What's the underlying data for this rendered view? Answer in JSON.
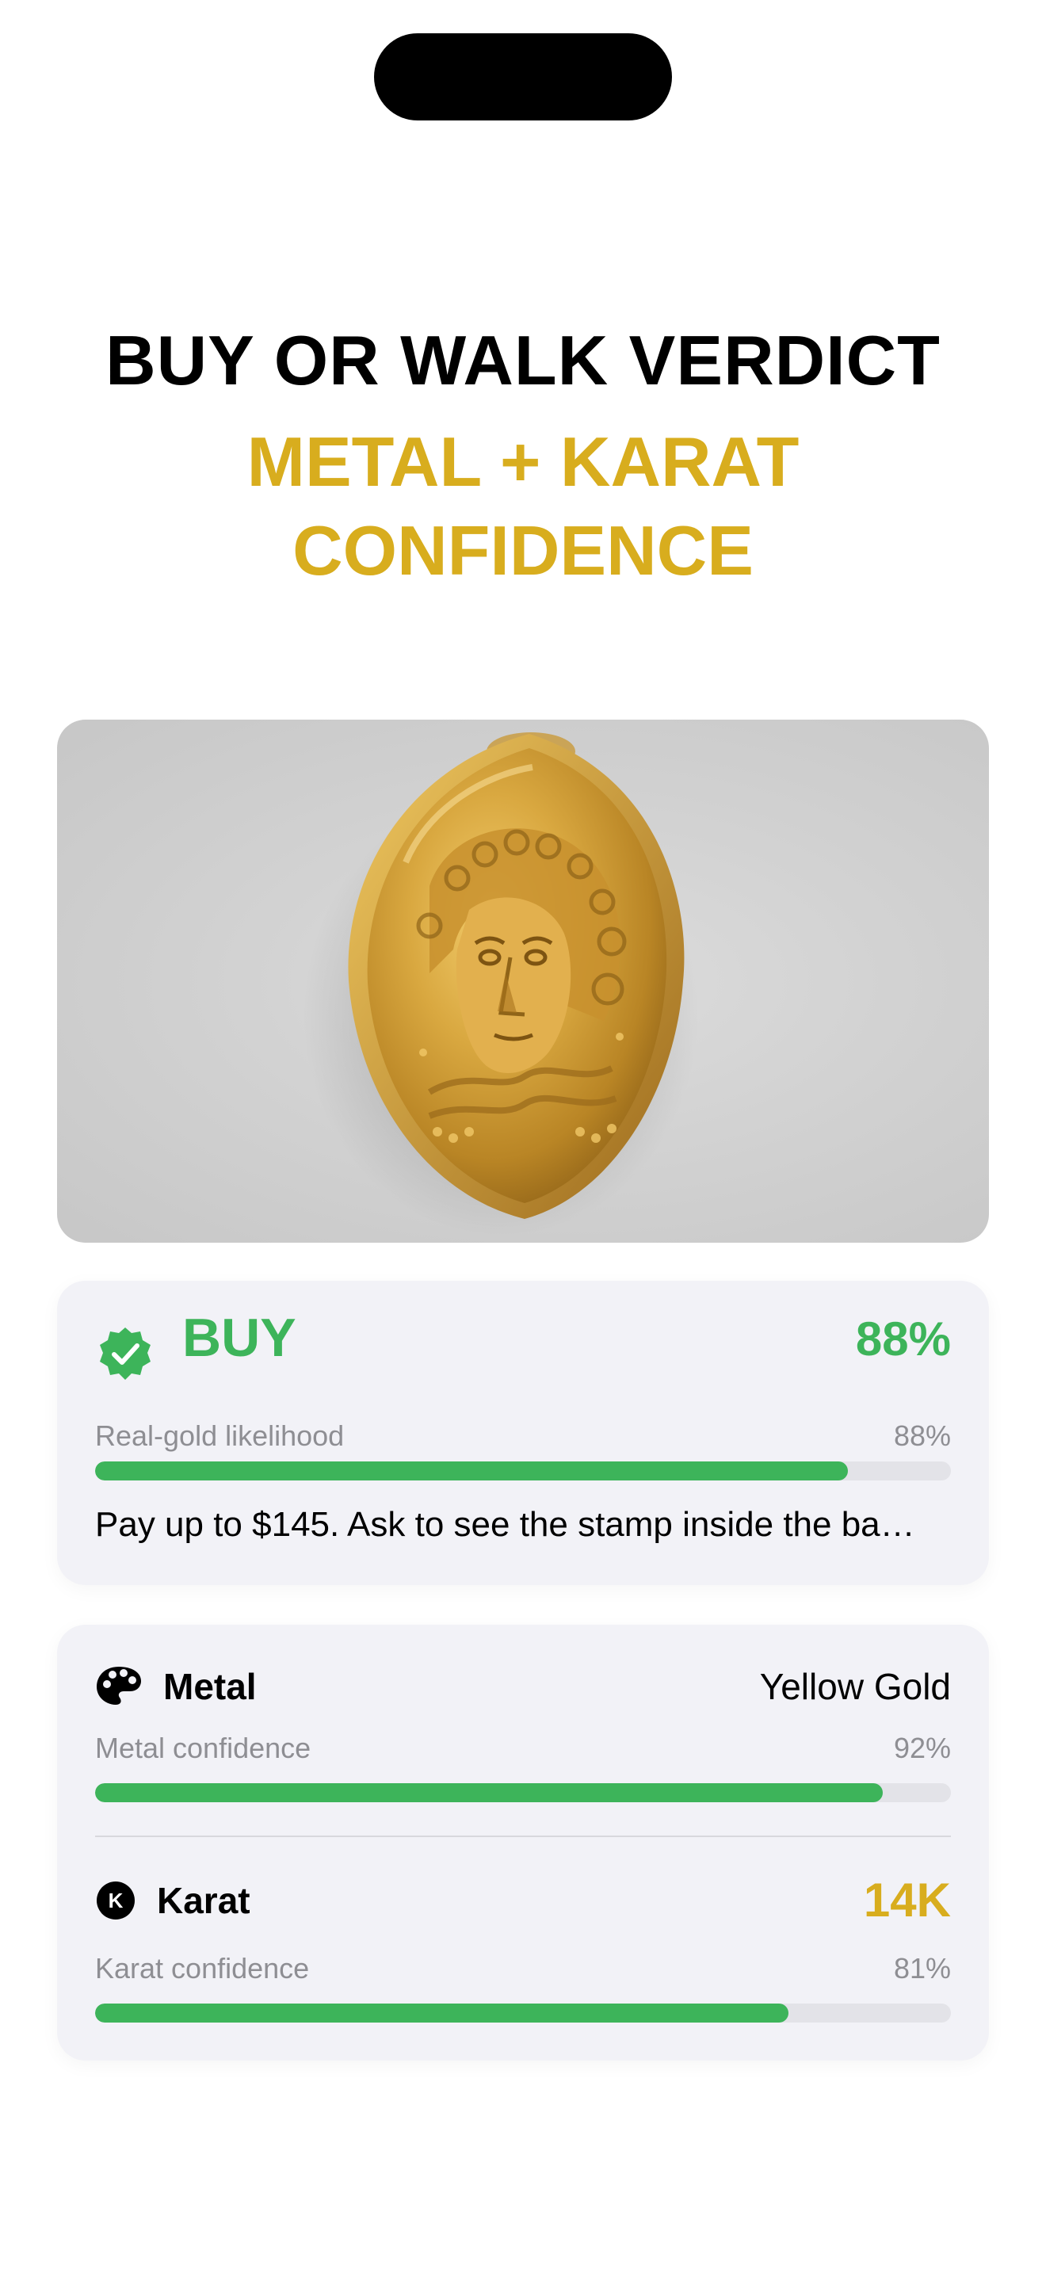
{
  "header": {
    "title": "BUY OR WALK VERDICT",
    "subtitle_line1": "METAL + KARAT",
    "subtitle_line2": "CONFIDENCE"
  },
  "photo": {
    "subject": "gold ring with carved face"
  },
  "verdict": {
    "label": "BUY",
    "percent_text": "88%",
    "likelihood_label": "Real-gold likelihood",
    "likelihood_value_text": "88%",
    "likelihood_fraction": 0.88,
    "advice": "Pay up to $145. Ask to see the stamp inside the ba…",
    "icon": "verified-badge-icon",
    "color": "#3db45a"
  },
  "metal": {
    "label": "Metal",
    "value": "Yellow Gold",
    "icon": "palette-icon",
    "confidence_label": "Metal confidence",
    "confidence_text": "92%",
    "confidence_fraction": 0.92
  },
  "karat": {
    "label": "Karat",
    "value": "14K",
    "icon": "karat-badge-icon",
    "icon_letter": "K",
    "confidence_label": "Karat confidence",
    "confidence_text": "81%",
    "confidence_fraction": 0.81
  },
  "colors": {
    "accent_gold": "#d8ad1e",
    "success_green": "#3db45a",
    "card_background": "#f2f2f7",
    "track_gray": "#e3e3e8"
  }
}
